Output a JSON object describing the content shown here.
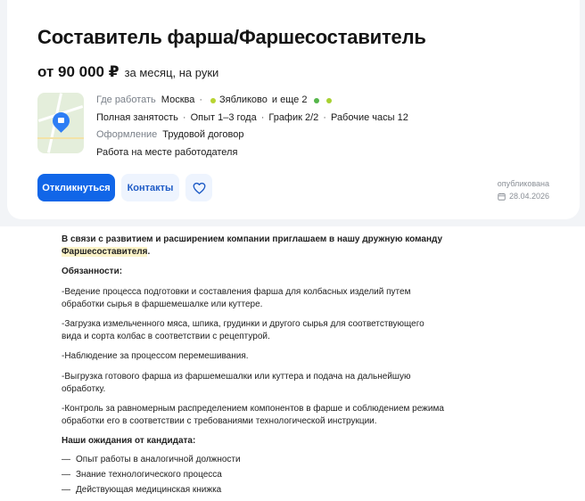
{
  "vacancy": {
    "title": "Составитель фарша/Фаршесоставитель",
    "salary_amount": "от 90 000 ₽",
    "salary_period": "за месяц, на руки",
    "location_label": "Где работать",
    "city": "Москва",
    "metro": "Зябликово",
    "more_locations": "и еще 2",
    "employment": "Полная занятость",
    "experience": "Опыт 1–3 года",
    "schedule": "График 2/2",
    "hours": "Рабочие часы 12",
    "contract_label": "Оформление",
    "contract": "Трудовой договор",
    "workplace": "Работа на месте работодателя",
    "published_label": "опубликована",
    "published_date": "28.04.2026"
  },
  "actions": {
    "apply": "Откликнуться",
    "contacts": "Контакты"
  },
  "description": {
    "intro": "В связи с развитием и расширением компании приглашаем в нашу дружную команду",
    "intro_highlight": "Фаршесоставителя",
    "intro_end": ".",
    "duties_title": "Обязанности:",
    "duty1": "-Ведение процесса подготовки и составления фарша для колбасных изделий путем обработки сырья в фаршемешалке или куттере.",
    "duty2": "-Загрузка измельченного мяса, шпика, грудинки и другого сырья для соответствующего вида и сорта колбас в соответствии с рецептурой.",
    "duty3": "-Наблюдение за процессом перемешивания.",
    "duty4": "-Выгрузка готового фарша из фаршемешалки или куттера и подача на дальнейшую обработку.",
    "duty5": "-Контроль за равномерным распределением компонентов в фарше и соблюдением режима обработки его в соответствии с требованиями технологической инструкции.",
    "expect_title": "Наши ожидания от кандидата:",
    "req1": "Опыт работы в аналогичной должности",
    "req2": "Знание технологического процесса",
    "req3": "Действующая медицинская книжка"
  },
  "colors": {
    "accent": "#1166e8",
    "highlight": "#fbf3c8"
  },
  "icons": [
    "map-pin-icon",
    "metro-dot-icon",
    "heart-icon",
    "calendar-icon"
  ]
}
